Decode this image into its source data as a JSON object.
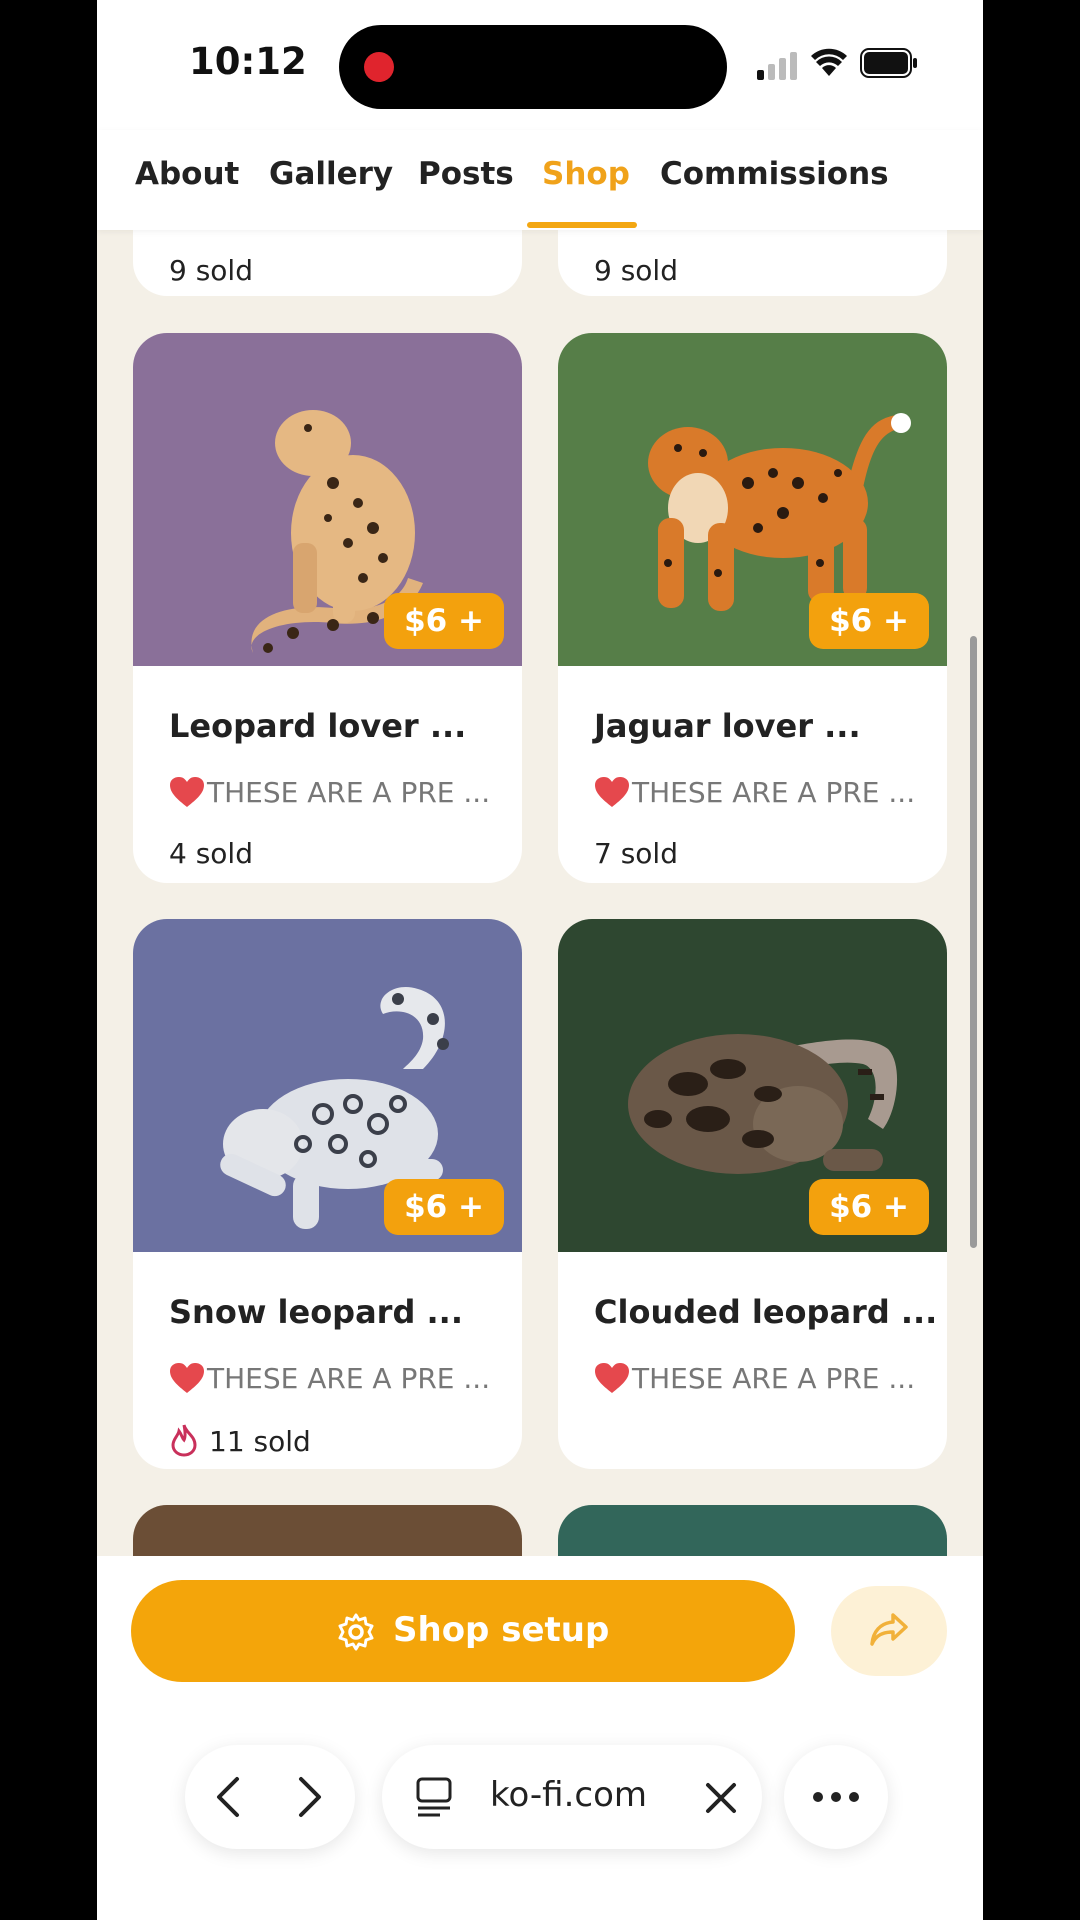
{
  "status_bar": {
    "time": "10:12"
  },
  "tabs": [
    {
      "label": "About"
    },
    {
      "label": "Gallery"
    },
    {
      "label": "Posts"
    },
    {
      "label": "Shop",
      "active": true
    },
    {
      "label": "Commissions"
    }
  ],
  "top_cards": [
    {
      "sold": "9 sold"
    },
    {
      "sold": "9 sold"
    }
  ],
  "products": [
    {
      "title": "Leopard lover ...",
      "desc": "THESE ARE A PRE ...",
      "price": "$6 +",
      "sold": "4 sold",
      "bg": "#8a7099"
    },
    {
      "title": "Jaguar lover ...",
      "desc": "THESE ARE A PRE ...",
      "price": "$6 +",
      "sold": "7 sold",
      "bg": "#567e48"
    },
    {
      "title": "Snow leopard ...",
      "desc": "THESE ARE A PRE ...",
      "price": "$6 +",
      "sold": "11 sold",
      "bg": "#6b71a1"
    },
    {
      "title": "Clouded leopard ...",
      "desc": "THESE ARE A PRE ...",
      "price": "$6 +",
      "sold": "",
      "bg": "#2e4730"
    }
  ],
  "partial_cards": [
    {
      "bg": "#6b4e36"
    },
    {
      "bg": "#32665a"
    }
  ],
  "actions": {
    "shop_setup": "Shop setup"
  },
  "browser": {
    "url": "ko-fi.com"
  },
  "colors": {
    "accent": "#f3a712",
    "heart": "#e5484d"
  }
}
